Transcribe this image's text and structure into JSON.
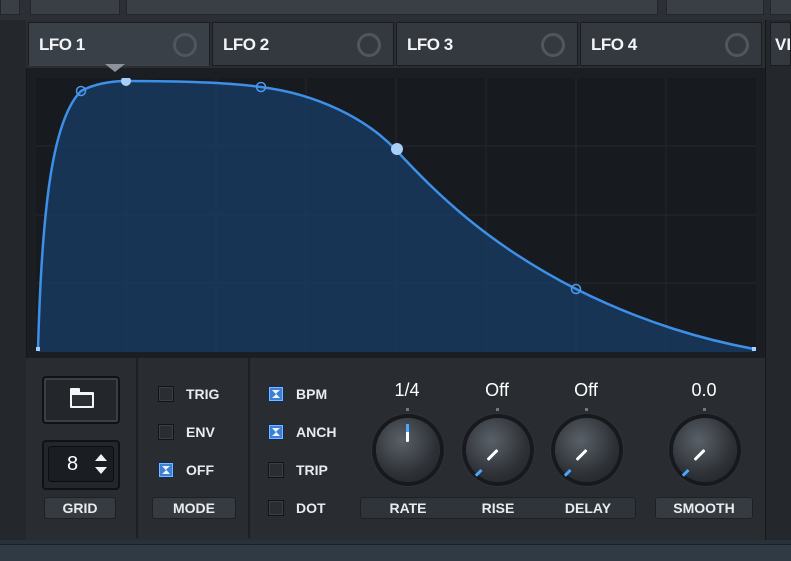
{
  "tabs": [
    {
      "label": "LFO 1",
      "active": true
    },
    {
      "label": "LFO 2",
      "active": false
    },
    {
      "label": "LFO 3",
      "active": false
    },
    {
      "label": "LFO 4",
      "active": false
    }
  ],
  "next_tab_partial": "VI",
  "grid": {
    "value": "8",
    "label": "GRID"
  },
  "mode": {
    "label": "MODE",
    "options": [
      {
        "label": "TRIG",
        "checked": false
      },
      {
        "label": "ENV",
        "checked": false
      },
      {
        "label": "OFF",
        "checked": true
      }
    ]
  },
  "options": [
    {
      "label": "BPM",
      "checked": true
    },
    {
      "label": "ANCH",
      "checked": true
    },
    {
      "label": "TRIP",
      "checked": false
    },
    {
      "label": "DOT",
      "checked": false
    }
  ],
  "knobs": [
    {
      "label": "RATE",
      "value": "1/4"
    },
    {
      "label": "RISE",
      "value": "Off"
    },
    {
      "label": "DELAY",
      "value": "Off"
    },
    {
      "label": "SMOOTH",
      "value": "0.0"
    }
  ],
  "colors": {
    "accent": "#3d8fe8",
    "curve_fill": "#173a5e",
    "background": "#171a1e"
  }
}
